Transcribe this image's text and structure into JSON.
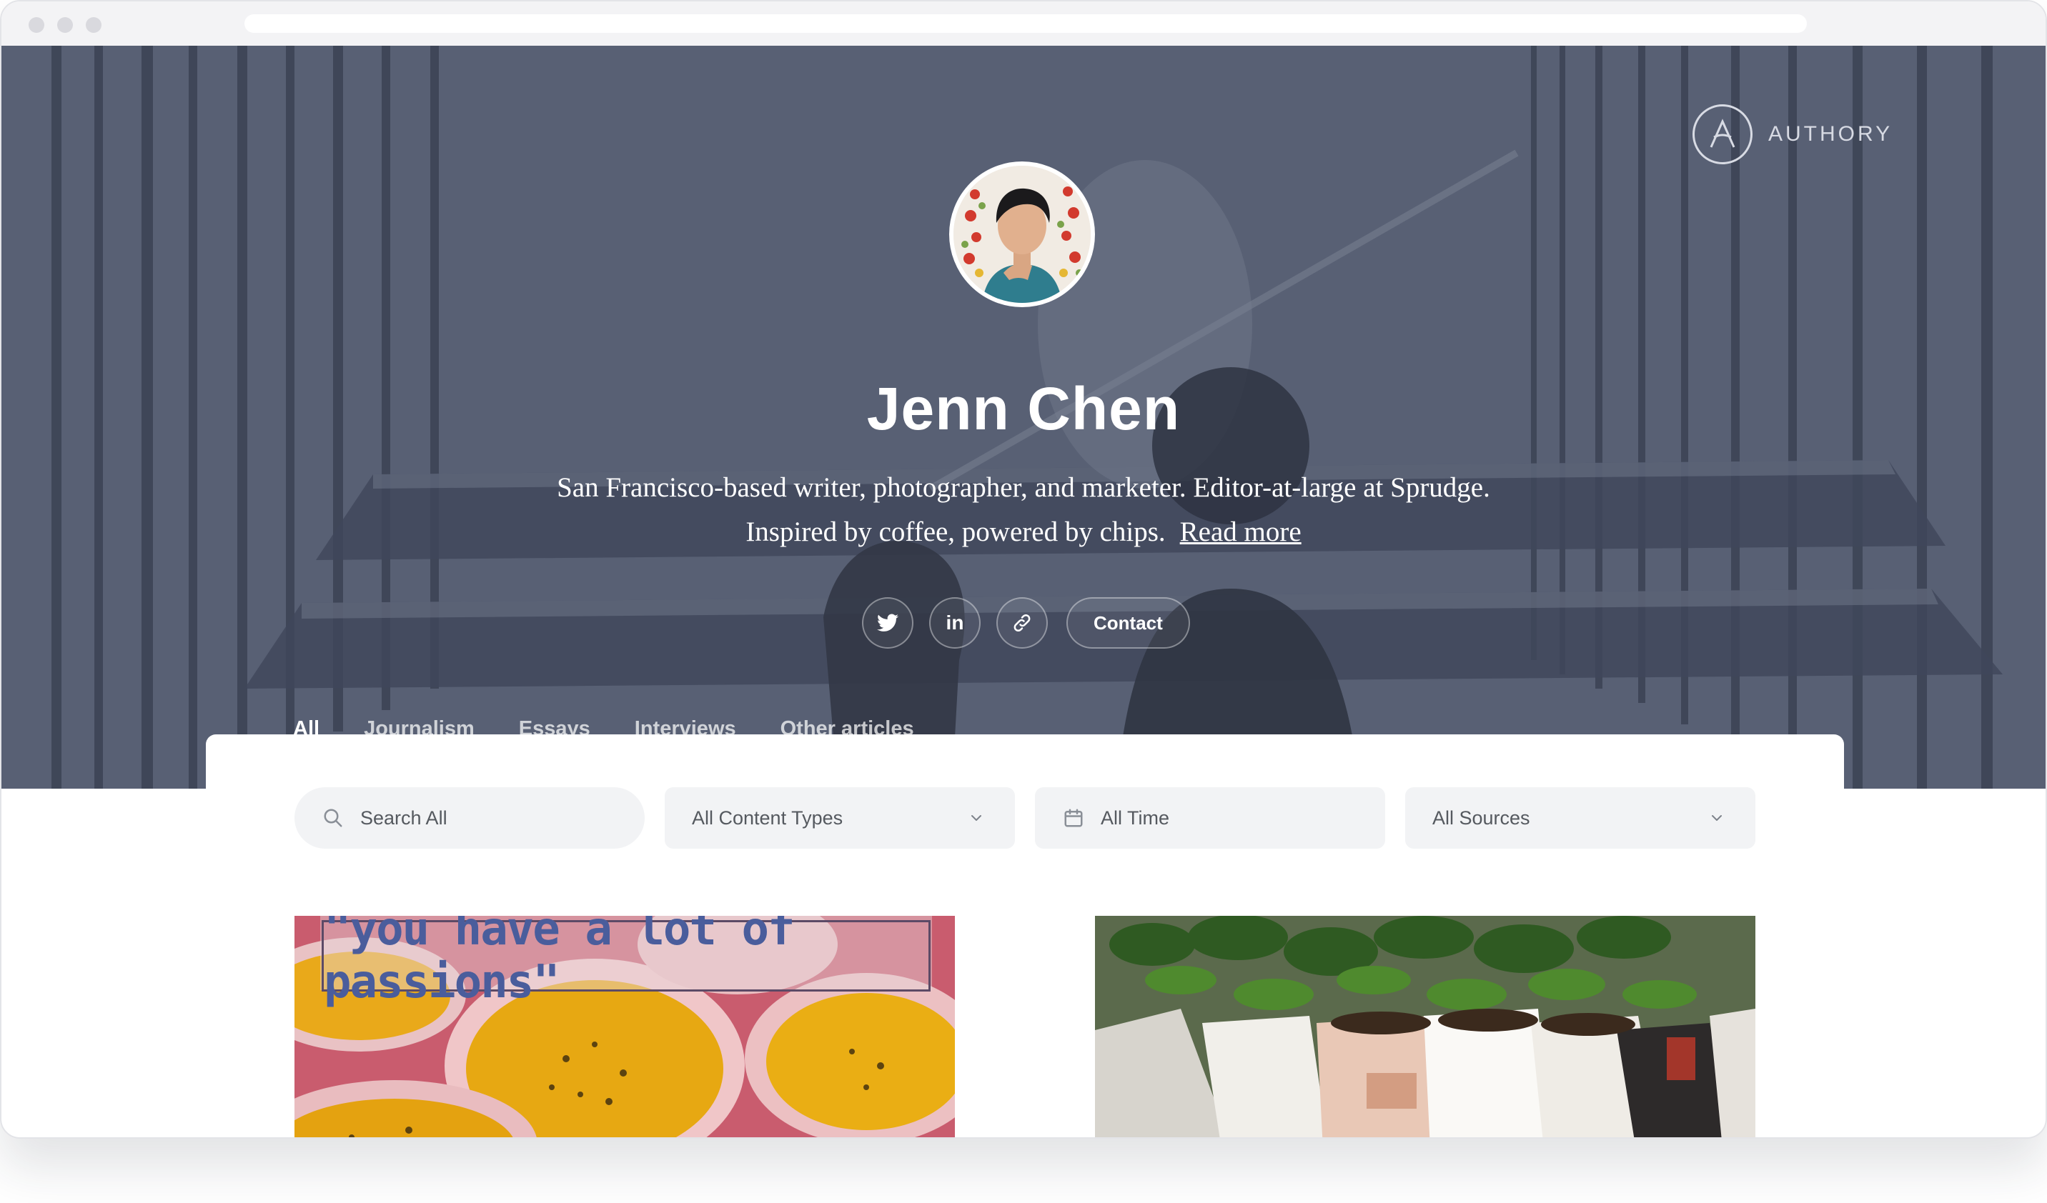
{
  "profile": {
    "name": "Jenn Chen",
    "bio_line1": "San Francisco-based writer, photographer, and marketer. Editor-at-large at Sprudge.",
    "bio_line2": "Inspired by coffee, powered by chips.",
    "read_more": "Read more"
  },
  "brand": {
    "name": "AUTHORY",
    "icon": "authory-logo-icon"
  },
  "socials": {
    "items": [
      {
        "icon": "twitter-icon"
      },
      {
        "icon": "linkedin-icon",
        "glyph": "in"
      },
      {
        "icon": "link-icon"
      }
    ],
    "contact_label": "Contact"
  },
  "tabs": [
    {
      "label": "All",
      "active": true
    },
    {
      "label": "Journalism",
      "active": false
    },
    {
      "label": "Essays",
      "active": false
    },
    {
      "label": "Interviews",
      "active": false
    },
    {
      "label": "Other articles",
      "active": false
    }
  ],
  "filters": {
    "search_placeholder": "Search All",
    "content_types": "All Content Types",
    "time": "All Time",
    "sources": "All Sources"
  },
  "articles": [
    {
      "image_caption": "\"you have a lot of passions\""
    },
    {
      "image_caption": ""
    }
  ],
  "colors": {
    "accent": "#3b6cf0",
    "hero_overlay": "#485066",
    "filter_bg": "#f2f3f5"
  }
}
